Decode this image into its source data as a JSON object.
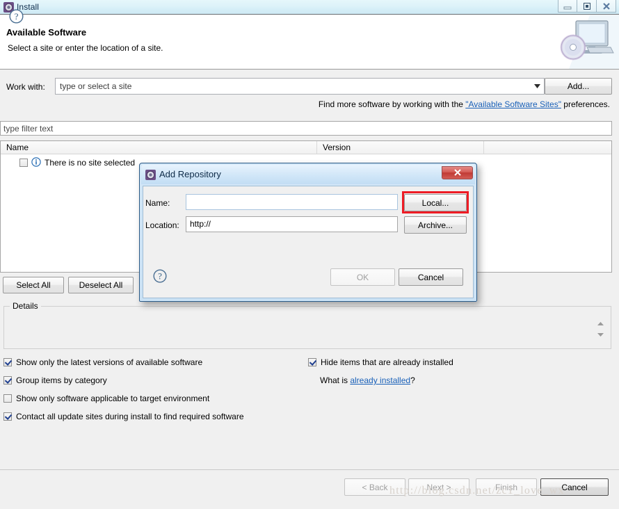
{
  "window": {
    "title": "Install",
    "icon": "install-gear-icon",
    "controls": [
      {
        "name": "minimize",
        "glyph": "minimize-icon"
      },
      {
        "name": "restore",
        "glyph": "restore-icon"
      },
      {
        "name": "close",
        "glyph": "close-icon"
      }
    ]
  },
  "header": {
    "title": "Available Software",
    "subtitle": "Select a site or enter the location of a site.",
    "art_icon": "computer-disc-icon"
  },
  "work_with": {
    "label": "Work with:",
    "value": "",
    "placeholder": "type or select a site",
    "dropdown_icon": "chevron-down-icon",
    "add_button": "Add..."
  },
  "find_more": {
    "prefix": "Find more software by working with the ",
    "link": "\"Available Software Sites\"",
    "suffix": " preferences."
  },
  "filter": {
    "value": "",
    "placeholder": "type filter text"
  },
  "table": {
    "columns": [
      "Name",
      "Version",
      ""
    ],
    "rows": [
      {
        "checked": false,
        "icon": "info-icon",
        "name": "There is no site selected"
      }
    ]
  },
  "selection_buttons": {
    "select_all": "Select All",
    "deselect_all": "Deselect All"
  },
  "details": {
    "legend": "Details",
    "content": "",
    "spinner_up_icon": "triangle-up-icon",
    "spinner_down_icon": "triangle-down-icon"
  },
  "options": {
    "left": [
      {
        "label": "Show only the latest versions of available software",
        "checked": true
      },
      {
        "label": "Group items by category",
        "checked": true
      },
      {
        "label": "Show only software applicable to target environment",
        "checked": false
      },
      {
        "label": "Contact all update sites during install to find required software",
        "checked": true
      }
    ],
    "right": [
      {
        "label": "Hide items that are already installed",
        "checked": true
      }
    ],
    "what_is": {
      "prefix": "What is ",
      "link": "already installed",
      "suffix": "?"
    }
  },
  "footer": {
    "help_icon": "help-question-icon",
    "buttons": [
      {
        "label": "< Back",
        "enabled": false
      },
      {
        "label": "Next >",
        "enabled": false
      },
      {
        "label": "Finish",
        "enabled": false
      },
      {
        "label": "Cancel",
        "enabled": true
      }
    ],
    "watermark": "http://blog.csdn.net/zc1_love_wx"
  },
  "dialog": {
    "title": "Add Repository",
    "icon": "install-gear-icon",
    "close_icon": "close-icon",
    "name_label": "Name:",
    "name_value": "",
    "location_label": "Location:",
    "location_value": "http://",
    "local_button": "Local...",
    "archive_button": "Archive...",
    "ok_button": "OK",
    "cancel_button": "Cancel",
    "help_icon": "help-question-icon",
    "highlight_color": "#ee1c25",
    "highlighted_element": "local-button"
  },
  "colors": {
    "link": "#1960b8",
    "titlebar": "#ddf2f9",
    "dialog_titlebar": "#d2e7f8",
    "close_button": "#c03a34",
    "highlight": "#ee1c25",
    "background": "#f0f0f0"
  }
}
